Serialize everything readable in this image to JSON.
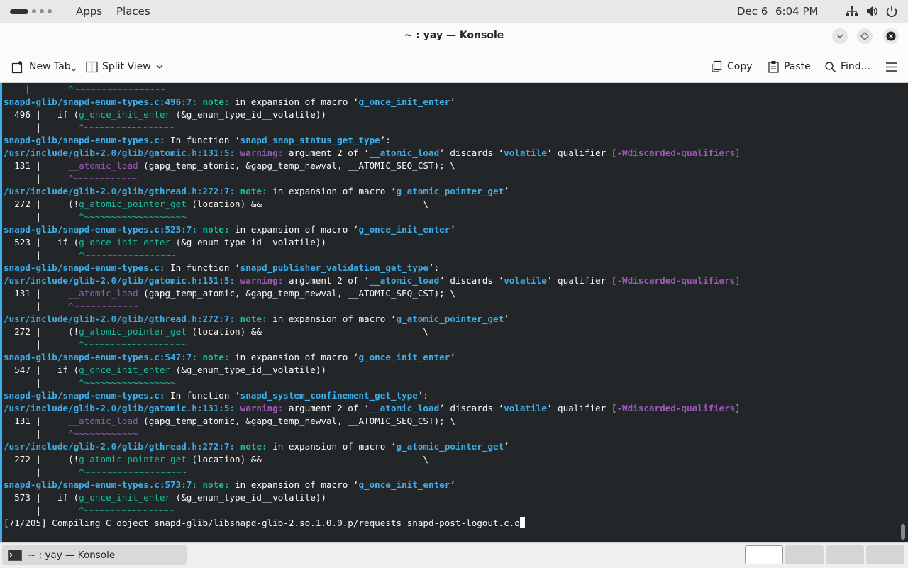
{
  "topbar": {
    "apps": "Apps",
    "places": "Places",
    "date": "Dec 6",
    "time": "6:04 PM",
    "icons": [
      "network-icon",
      "volume-icon",
      "power-icon"
    ]
  },
  "window": {
    "title": "~ : yay — Konsole"
  },
  "toolbar": {
    "new_tab": "New Tab",
    "split_view": "Split View",
    "copy": "Copy",
    "paste": "Paste",
    "find": "Find..."
  },
  "terminal": {
    "lines": [
      [
        {
          "t": "    |       "
        },
        {
          "t": "^~~~~~~~~~~~~~~~~~",
          "c": "c-caret"
        }
      ],
      [
        {
          "t": "snapd-glib/snapd-enum-types.c:496:7: ",
          "c": "c-path"
        },
        {
          "t": "note: ",
          "c": "c-note"
        },
        {
          "t": "in expansion of macro ‘"
        },
        {
          "t": "g_once_init_enter",
          "c": "c-id"
        },
        {
          "t": "’"
        }
      ],
      [
        {
          "t": "  496 |   if ("
        },
        {
          "t": "g_once_init_enter",
          "c": "c-gonce"
        },
        {
          "t": " (&g_enum_type_id__volatile))"
        }
      ],
      [
        {
          "t": "      |       "
        },
        {
          "t": "^~~~~~~~~~~~~~~~~~",
          "c": "c-caret"
        }
      ],
      [
        {
          "t": "snapd-glib/snapd-enum-types.c: ",
          "c": "c-path"
        },
        {
          "t": "In function ‘"
        },
        {
          "t": "snapd_snap_status_get_type",
          "c": "c-id"
        },
        {
          "t": "’:"
        }
      ],
      [
        {
          "t": "/usr/include/glib-2.0/glib/gatomic.h:131:5: ",
          "c": "c-path"
        },
        {
          "t": "warning: ",
          "c": "c-warn"
        },
        {
          "t": "argument 2 of ‘"
        },
        {
          "t": "__atomic_load",
          "c": "c-id"
        },
        {
          "t": "’ discards ‘"
        },
        {
          "t": "volatile",
          "c": "c-id"
        },
        {
          "t": "’ qualifier ["
        },
        {
          "t": "-Wdiscarded-qualifiers",
          "c": "c-err"
        },
        {
          "t": "]"
        }
      ],
      [
        {
          "t": "  131 |     "
        },
        {
          "t": "__atomic_load",
          "c": "c-atom"
        },
        {
          "t": " (gapg_temp_atomic, &gapg_temp_newval, __ATOMIC_SEQ_CST); \\"
        }
      ],
      [
        {
          "t": "      |     "
        },
        {
          "t": "^~~~~~~~~~~~~",
          "c": "c-atom"
        }
      ],
      [
        {
          "t": "/usr/include/glib-2.0/glib/gthread.h:272:7: ",
          "c": "c-path"
        },
        {
          "t": "note: ",
          "c": "c-note"
        },
        {
          "t": "in expansion of macro ‘"
        },
        {
          "t": "g_atomic_pointer_get",
          "c": "c-id"
        },
        {
          "t": "’"
        }
      ],
      [
        {
          "t": "  272 |     (!"
        },
        {
          "t": "g_atomic_pointer_get",
          "c": "c-gonce"
        },
        {
          "t": " (location) &&                              \\"
        }
      ],
      [
        {
          "t": "      |       "
        },
        {
          "t": "^~~~~~~~~~~~~~~~~~~~",
          "c": "c-caret"
        }
      ],
      [
        {
          "t": "snapd-glib/snapd-enum-types.c:523:7: ",
          "c": "c-path"
        },
        {
          "t": "note: ",
          "c": "c-note"
        },
        {
          "t": "in expansion of macro ‘"
        },
        {
          "t": "g_once_init_enter",
          "c": "c-id"
        },
        {
          "t": "’"
        }
      ],
      [
        {
          "t": "  523 |   if ("
        },
        {
          "t": "g_once_init_enter",
          "c": "c-gonce"
        },
        {
          "t": " (&g_enum_type_id__volatile))"
        }
      ],
      [
        {
          "t": "      |       "
        },
        {
          "t": "^~~~~~~~~~~~~~~~~~",
          "c": "c-caret"
        }
      ],
      [
        {
          "t": "snapd-glib/snapd-enum-types.c: ",
          "c": "c-path"
        },
        {
          "t": "In function ‘"
        },
        {
          "t": "snapd_publisher_validation_get_type",
          "c": "c-id"
        },
        {
          "t": "’:"
        }
      ],
      [
        {
          "t": "/usr/include/glib-2.0/glib/gatomic.h:131:5: ",
          "c": "c-path"
        },
        {
          "t": "warning: ",
          "c": "c-warn"
        },
        {
          "t": "argument 2 of ‘"
        },
        {
          "t": "__atomic_load",
          "c": "c-id"
        },
        {
          "t": "’ discards ‘"
        },
        {
          "t": "volatile",
          "c": "c-id"
        },
        {
          "t": "’ qualifier ["
        },
        {
          "t": "-Wdiscarded-qualifiers",
          "c": "c-err"
        },
        {
          "t": "]"
        }
      ],
      [
        {
          "t": "  131 |     "
        },
        {
          "t": "__atomic_load",
          "c": "c-atom"
        },
        {
          "t": " (gapg_temp_atomic, &gapg_temp_newval, __ATOMIC_SEQ_CST); \\"
        }
      ],
      [
        {
          "t": "      |     "
        },
        {
          "t": "^~~~~~~~~~~~~",
          "c": "c-atom"
        }
      ],
      [
        {
          "t": "/usr/include/glib-2.0/glib/gthread.h:272:7: ",
          "c": "c-path"
        },
        {
          "t": "note: ",
          "c": "c-note"
        },
        {
          "t": "in expansion of macro ‘"
        },
        {
          "t": "g_atomic_pointer_get",
          "c": "c-id"
        },
        {
          "t": "’"
        }
      ],
      [
        {
          "t": "  272 |     (!"
        },
        {
          "t": "g_atomic_pointer_get",
          "c": "c-gonce"
        },
        {
          "t": " (location) &&                              \\"
        }
      ],
      [
        {
          "t": "      |       "
        },
        {
          "t": "^~~~~~~~~~~~~~~~~~~~",
          "c": "c-caret"
        }
      ],
      [
        {
          "t": "snapd-glib/snapd-enum-types.c:547:7: ",
          "c": "c-path"
        },
        {
          "t": "note: ",
          "c": "c-note"
        },
        {
          "t": "in expansion of macro ‘"
        },
        {
          "t": "g_once_init_enter",
          "c": "c-id"
        },
        {
          "t": "’"
        }
      ],
      [
        {
          "t": "  547 |   if ("
        },
        {
          "t": "g_once_init_enter",
          "c": "c-gonce"
        },
        {
          "t": " (&g_enum_type_id__volatile))"
        }
      ],
      [
        {
          "t": "      |       "
        },
        {
          "t": "^~~~~~~~~~~~~~~~~~",
          "c": "c-caret"
        }
      ],
      [
        {
          "t": "snapd-glib/snapd-enum-types.c: ",
          "c": "c-path"
        },
        {
          "t": "In function ‘"
        },
        {
          "t": "snapd_system_confinement_get_type",
          "c": "c-id"
        },
        {
          "t": "’:"
        }
      ],
      [
        {
          "t": "/usr/include/glib-2.0/glib/gatomic.h:131:5: ",
          "c": "c-path"
        },
        {
          "t": "warning: ",
          "c": "c-warn"
        },
        {
          "t": "argument 2 of ‘"
        },
        {
          "t": "__atomic_load",
          "c": "c-id"
        },
        {
          "t": "’ discards ‘"
        },
        {
          "t": "volatile",
          "c": "c-id"
        },
        {
          "t": "’ qualifier ["
        },
        {
          "t": "-Wdiscarded-qualifiers",
          "c": "c-err"
        },
        {
          "t": "]"
        }
      ],
      [
        {
          "t": "  131 |     "
        },
        {
          "t": "__atomic_load",
          "c": "c-atom"
        },
        {
          "t": " (gapg_temp_atomic, &gapg_temp_newval, __ATOMIC_SEQ_CST); \\"
        }
      ],
      [
        {
          "t": "      |     "
        },
        {
          "t": "^~~~~~~~~~~~~",
          "c": "c-atom"
        }
      ],
      [
        {
          "t": "/usr/include/glib-2.0/glib/gthread.h:272:7: ",
          "c": "c-path"
        },
        {
          "t": "note: ",
          "c": "c-note"
        },
        {
          "t": "in expansion of macro ‘"
        },
        {
          "t": "g_atomic_pointer_get",
          "c": "c-id"
        },
        {
          "t": "’"
        }
      ],
      [
        {
          "t": "  272 |     (!"
        },
        {
          "t": "g_atomic_pointer_get",
          "c": "c-gonce"
        },
        {
          "t": " (location) &&                              \\"
        }
      ],
      [
        {
          "t": "      |       "
        },
        {
          "t": "^~~~~~~~~~~~~~~~~~~~",
          "c": "c-caret"
        }
      ],
      [
        {
          "t": "snapd-glib/snapd-enum-types.c:573:7: ",
          "c": "c-path"
        },
        {
          "t": "note: ",
          "c": "c-note"
        },
        {
          "t": "in expansion of macro ‘"
        },
        {
          "t": "g_once_init_enter",
          "c": "c-id"
        },
        {
          "t": "’"
        }
      ],
      [
        {
          "t": "  573 |   if ("
        },
        {
          "t": "g_once_init_enter",
          "c": "c-gonce"
        },
        {
          "t": " (&g_enum_type_id__volatile))"
        }
      ],
      [
        {
          "t": "      |       "
        },
        {
          "t": "^~~~~~~~~~~~~~~~~~",
          "c": "c-caret"
        }
      ],
      [
        {
          "t": "[71/205] Compiling C object snapd-glib/libsnapd-glib-2.so.1.0.0.p/requests_snapd-post-logout.c.o"
        }
      ]
    ]
  },
  "taskbar": {
    "task_label": "~ : yay — Konsole"
  }
}
